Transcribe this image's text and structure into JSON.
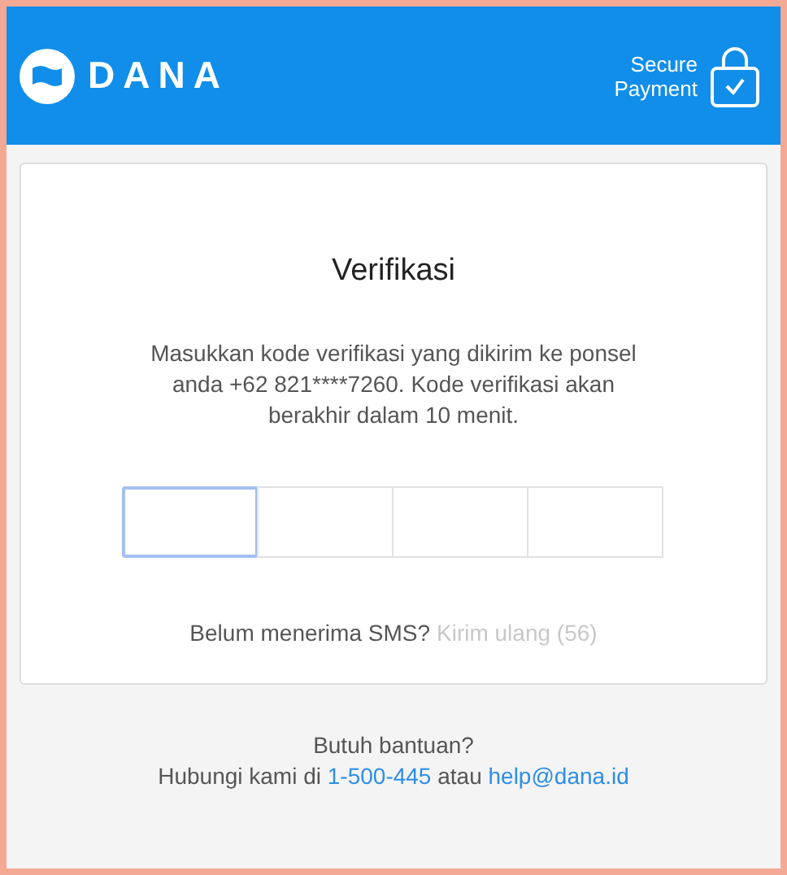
{
  "header": {
    "logo_text": "DANA",
    "secure_label": [
      "Secure",
      "Payment"
    ]
  },
  "card": {
    "title": "Verifikasi",
    "message": "Masukkan kode verifikasi yang dikirim ke ponsel anda +62 821****7260. Kode verifikasi akan berakhir dalam 10 menit.",
    "code_boxes": [
      {
        "selected": true
      },
      {
        "selected": false
      },
      {
        "selected": false
      },
      {
        "selected": false
      }
    ],
    "resend_prompt": "Belum menerima SMS?",
    "resend_link": {
      "label": "Kirim ulang (56)",
      "disabled": true
    }
  },
  "footer": {
    "help_title": "Butuh bantuan?",
    "contact_prefix": "Hubungi kami di",
    "phone": "1-500-445",
    "joiner": "atau",
    "email": "help@dana.id"
  }
}
